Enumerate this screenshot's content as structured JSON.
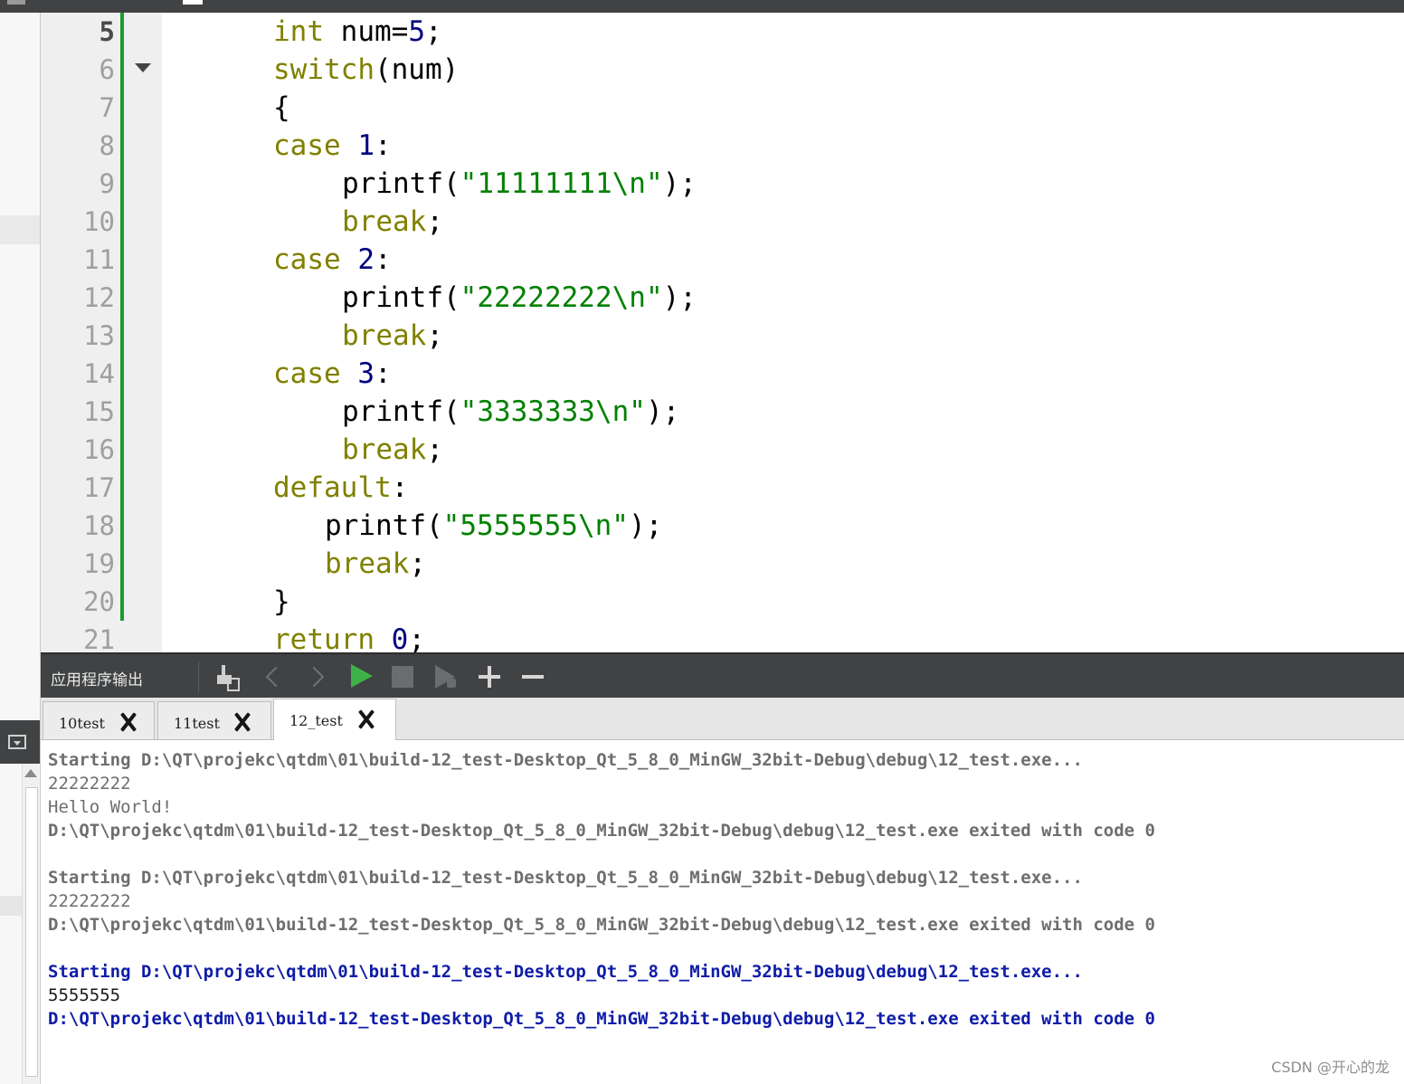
{
  "editor": {
    "lines": [
      {
        "n": "5",
        "current": true,
        "indent": 4,
        "tokens": [
          {
            "t": "int",
            "c": "kw"
          },
          {
            "t": " num=",
            "c": ""
          },
          {
            "t": "5",
            "c": "num"
          },
          {
            "t": ";",
            "c": ""
          }
        ]
      },
      {
        "n": "6",
        "indent": 4,
        "tokens": [
          {
            "t": "switch",
            "c": "kw"
          },
          {
            "t": "(num)",
            "c": ""
          }
        ]
      },
      {
        "n": "7",
        "indent": 4,
        "tokens": [
          {
            "t": "{",
            "c": ""
          }
        ]
      },
      {
        "n": "8",
        "indent": 4,
        "tokens": [
          {
            "t": "case",
            "c": "kw"
          },
          {
            "t": " ",
            "c": ""
          },
          {
            "t": "1",
            "c": "num"
          },
          {
            "t": ":",
            "c": ""
          }
        ]
      },
      {
        "n": "9",
        "indent": 8,
        "tokens": [
          {
            "t": "printf(",
            "c": ""
          },
          {
            "t": "\"11111111\\n\"",
            "c": "str"
          },
          {
            "t": ");",
            "c": ""
          }
        ]
      },
      {
        "n": "10",
        "indent": 8,
        "tokens": [
          {
            "t": "break",
            "c": "kw"
          },
          {
            "t": ";",
            "c": ""
          }
        ]
      },
      {
        "n": "11",
        "indent": 4,
        "tokens": [
          {
            "t": "case",
            "c": "kw"
          },
          {
            "t": " ",
            "c": ""
          },
          {
            "t": "2",
            "c": "num"
          },
          {
            "t": ":",
            "c": ""
          }
        ]
      },
      {
        "n": "12",
        "indent": 8,
        "tokens": [
          {
            "t": "printf(",
            "c": ""
          },
          {
            "t": "\"22222222\\n\"",
            "c": "str"
          },
          {
            "t": ");",
            "c": ""
          }
        ]
      },
      {
        "n": "13",
        "indent": 8,
        "tokens": [
          {
            "t": "break",
            "c": "kw"
          },
          {
            "t": ";",
            "c": ""
          }
        ]
      },
      {
        "n": "14",
        "indent": 4,
        "tokens": [
          {
            "t": "case",
            "c": "kw"
          },
          {
            "t": " ",
            "c": ""
          },
          {
            "t": "3",
            "c": "num"
          },
          {
            "t": ":",
            "c": ""
          }
        ]
      },
      {
        "n": "15",
        "indent": 8,
        "tokens": [
          {
            "t": "printf(",
            "c": ""
          },
          {
            "t": "\"3333333\\n\"",
            "c": "str"
          },
          {
            "t": ");",
            "c": ""
          }
        ]
      },
      {
        "n": "16",
        "indent": 8,
        "tokens": [
          {
            "t": "break",
            "c": "kw"
          },
          {
            "t": ";",
            "c": ""
          }
        ]
      },
      {
        "n": "17",
        "indent": 4,
        "tokens": [
          {
            "t": "default",
            "c": "kw"
          },
          {
            "t": ":",
            "c": ""
          }
        ]
      },
      {
        "n": "18",
        "indent": 7,
        "tokens": [
          {
            "t": "printf(",
            "c": ""
          },
          {
            "t": "\"5555555\\n\"",
            "c": "str"
          },
          {
            "t": ");",
            "c": ""
          }
        ]
      },
      {
        "n": "19",
        "indent": 7,
        "tokens": [
          {
            "t": "break",
            "c": "kw"
          },
          {
            "t": ";",
            "c": ""
          }
        ]
      },
      {
        "n": "20",
        "indent": 4,
        "tokens": [
          {
            "t": "}",
            "c": ""
          }
        ]
      },
      {
        "n": "21",
        "indent": 4,
        "tokens": [
          {
            "t": "return",
            "c": "kw"
          },
          {
            "t": " ",
            "c": ""
          },
          {
            "t": "0",
            "c": "num"
          },
          {
            "t": ";",
            "c": ""
          }
        ]
      }
    ]
  },
  "output_panel": {
    "title": "应用程序输出",
    "toolbar": [
      {
        "name": "clean-output-icon"
      },
      {
        "name": "previous-icon"
      },
      {
        "name": "next-icon"
      },
      {
        "name": "run-icon"
      },
      {
        "name": "stop-icon"
      },
      {
        "name": "attach-debugger-icon"
      },
      {
        "name": "zoom-in-icon"
      },
      {
        "name": "zoom-out-icon"
      }
    ],
    "tabs": [
      {
        "label": "10test",
        "active": false
      },
      {
        "label": "11test",
        "active": false
      },
      {
        "label": "12_test",
        "active": true
      }
    ],
    "lines": [
      {
        "text": "Starting D:\\QT\\projekc\\qtdm\\01\\build-12_test-Desktop_Qt_5_8_0_MinGW_32bit-Debug\\debug\\12_test.exe...",
        "style": "gray",
        "bold": true
      },
      {
        "text": "22222222",
        "style": "gray",
        "bold": false
      },
      {
        "text": "Hello World!",
        "style": "gray",
        "bold": false
      },
      {
        "text": "D:\\QT\\projekc\\qtdm\\01\\build-12_test-Desktop_Qt_5_8_0_MinGW_32bit-Debug\\debug\\12_test.exe exited with code 0",
        "style": "gray",
        "bold": true
      },
      {
        "text": "",
        "style": "gray",
        "bold": false
      },
      {
        "text": "Starting D:\\QT\\projekc\\qtdm\\01\\build-12_test-Desktop_Qt_5_8_0_MinGW_32bit-Debug\\debug\\12_test.exe...",
        "style": "gray",
        "bold": true
      },
      {
        "text": "22222222",
        "style": "gray",
        "bold": false
      },
      {
        "text": "D:\\QT\\projekc\\qtdm\\01\\build-12_test-Desktop_Qt_5_8_0_MinGW_32bit-Debug\\debug\\12_test.exe exited with code 0",
        "style": "gray",
        "bold": true
      },
      {
        "text": "",
        "style": "gray",
        "bold": false
      },
      {
        "text": "Starting D:\\QT\\projekc\\qtdm\\01\\build-12_test-Desktop_Qt_5_8_0_MinGW_32bit-Debug\\debug\\12_test.exe...",
        "style": "blue",
        "bold": true
      },
      {
        "text": "5555555",
        "style": "norm",
        "bold": false
      },
      {
        "text": "D:\\QT\\projekc\\qtdm\\01\\build-12_test-Desktop_Qt_5_8_0_MinGW_32bit-Debug\\debug\\12_test.exe exited with code 0",
        "style": "blue",
        "bold": true
      }
    ]
  },
  "watermark": "CSDN @开心的龙",
  "colors": {
    "keyword": "#808000",
    "number": "#000080",
    "string": "#008000",
    "run_green": "#3eb248",
    "change_bar": "#1d9b2e",
    "output_blue": "#0e1ca8",
    "output_gray": "#6e6e6e",
    "toolbar_bg": "#404244"
  }
}
